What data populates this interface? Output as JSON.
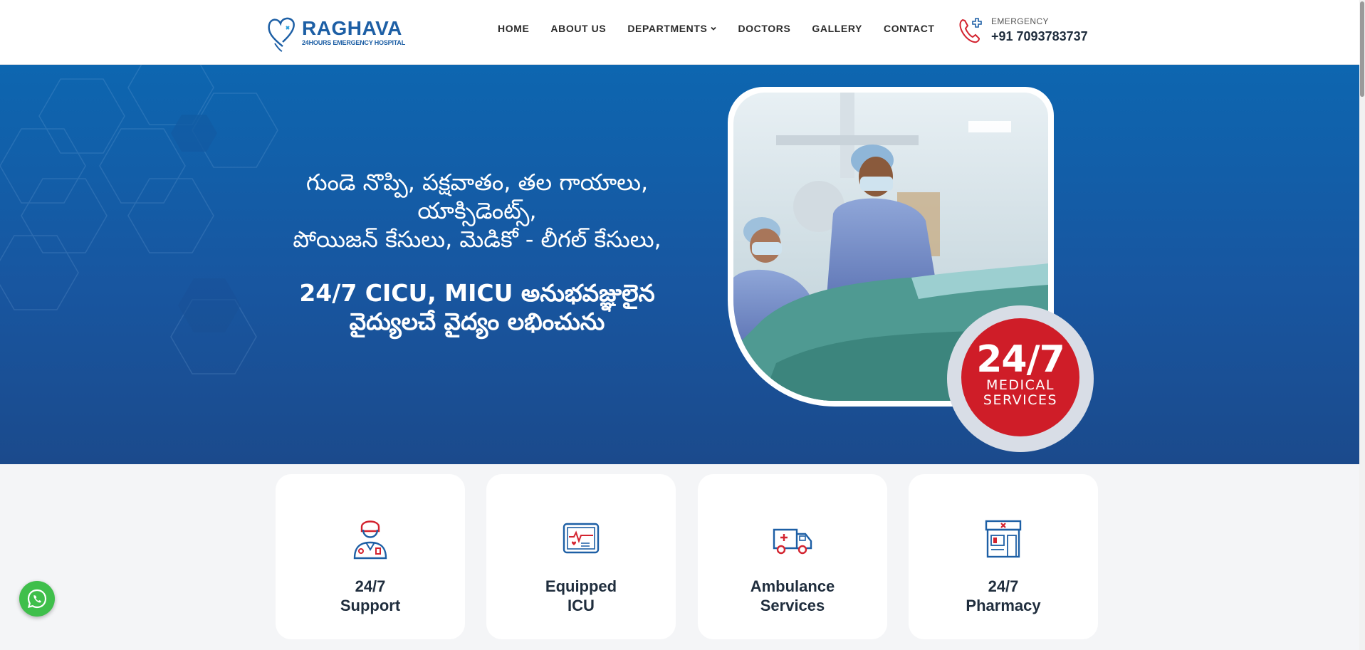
{
  "brand": {
    "name": "RAGHAVA",
    "tagline": "24HOURS EMERGENCY HOSPITAL"
  },
  "nav": {
    "items": [
      {
        "label": "HOME"
      },
      {
        "label": "ABOUT US"
      },
      {
        "label": "DEPARTMENTS"
      },
      {
        "label": "DOCTORS"
      },
      {
        "label": "GALLERY"
      },
      {
        "label": "CONTACT"
      }
    ]
  },
  "emergency": {
    "label": "EMERGENCY",
    "number": "+91 7093783737"
  },
  "hero": {
    "line1": "గుండె నొప్పి, పక్షవాతం, తల గాయాలు,",
    "line2": "యాక్సిడెంట్స్,",
    "line3": "పోయిజన్ కేసులు, మెడికో - లీగల్ కేసులు,",
    "bold1": "24/7 CICU, MICU అనుభవజ్ఞులైన",
    "bold2": "వైద్యులచే వైద్యం లభించును"
  },
  "badge": {
    "big": "24/7",
    "line1": "MEDICAL",
    "line2": "SERVICES"
  },
  "cards": [
    {
      "line1": "24/7",
      "line2": "Support",
      "icon": "doctor-icon"
    },
    {
      "line1": "Equipped",
      "line2": "ICU",
      "icon": "monitor-icon"
    },
    {
      "line1": "Ambulance",
      "line2": "Services",
      "icon": "ambulance-icon"
    },
    {
      "line1": "24/7",
      "line2": "Pharmacy",
      "icon": "pharmacy-icon"
    }
  ],
  "colors": {
    "brand_blue": "#1d5fa5",
    "hero_blue": "#0d66b0",
    "badge_red": "#cf1d28",
    "whatsapp_green": "#3fbf4b"
  }
}
